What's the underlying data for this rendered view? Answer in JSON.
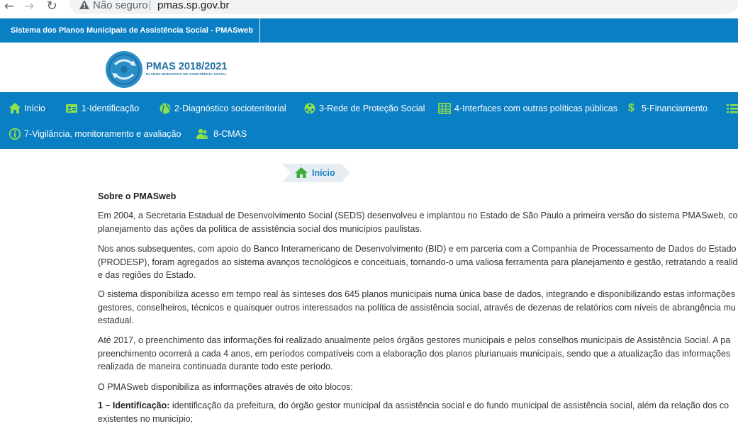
{
  "browser": {
    "security_label": "Não seguro",
    "url": "pmas.sp.gov.br"
  },
  "header": {
    "system_title": "Sistema dos Planos Municipais de Assistência Social - PMASweb",
    "logo_title": "PMAS 2018/2021",
    "logo_subtitle": "PLANOS MUNICIPAIS DE ASSISTÊNCIA SOCIAL"
  },
  "menu": {
    "items": [
      {
        "label": "Início",
        "icon": "home-icon"
      },
      {
        "label": "1-Identificação",
        "icon": "id-card-icon"
      },
      {
        "label": "2-Diagnóstico socioterritorial",
        "icon": "globe-icon"
      },
      {
        "label": "3-Rede de Proteção Social",
        "icon": "network-icon"
      },
      {
        "label": "4-Interfaces com outras políticas públicas",
        "icon": "grid-icon"
      },
      {
        "label": "5-Financiamento",
        "icon": "dollar-icon"
      },
      {
        "label": "7-Vigilância, monitoramento e avaliação",
        "icon": "info-icon"
      },
      {
        "label": "8-CMAS",
        "icon": "users-icon"
      }
    ]
  },
  "breadcrumb": {
    "label": "Início"
  },
  "content": {
    "title": "Sobre o PMASweb",
    "paragraphs": [
      [
        "Em 2004, a Secretaria Estadual de Desenvolvimento Social (SEDS) desenvolveu e implantou no Estado de São Paulo a primeira versão do sistema PMASweb, com",
        "planejamento das ações da política de assistência social dos municípios paulistas."
      ],
      [
        "Nos anos subsequentes, com apoio do Banco Interamericano de Desenvolvimento (BID) e em parceria com a Companhia de Processamento de Dados do Estado",
        "(PRODESP), foram agregados ao sistema avanços tecnológicos e conceituais, tornando-o uma valiosa ferramenta para planejamento e gestão, retratando a realid",
        "e das regiões do Estado."
      ],
      [
        "O sistema disponibiliza acesso em tempo real às sínteses dos 645 planos municipais numa única base de dados, integrando e disponibilizando estas informações",
        "gestores, conselheiros, técnicos e quaisquer outros interessados na política de assistência social, através de dezenas de relatórios com níveis de abrangência mu",
        "estadual."
      ],
      [
        "Até 2017, o preenchimento das informações foi realizado anualmente pelos órgãos gestores municipais e pelos conselhos municipais de Assistência Social. A pa",
        "preenchimento ocorrerá a cada 4 anos, em períodos compatíveis com a elaboração dos planos plurianuais municipais, sendo que a atualização das informações",
        "realizada de maneira continuada durante todo este período."
      ],
      [
        "O PMASweb disponibiliza as informações através de oito blocos:"
      ]
    ],
    "block1_title": "1 – Identificação:",
    "block1_text": [
      " identificação da prefeitura, do órgão gestor municipal da assistência social e do fundo municipal de assistência social, além da relação dos co",
      "existentes no município;"
    ]
  },
  "colors": {
    "primary_blue": "#0b7fc4",
    "icon_green": "#8ee04a",
    "crumb_blue": "#1a7fbe"
  }
}
